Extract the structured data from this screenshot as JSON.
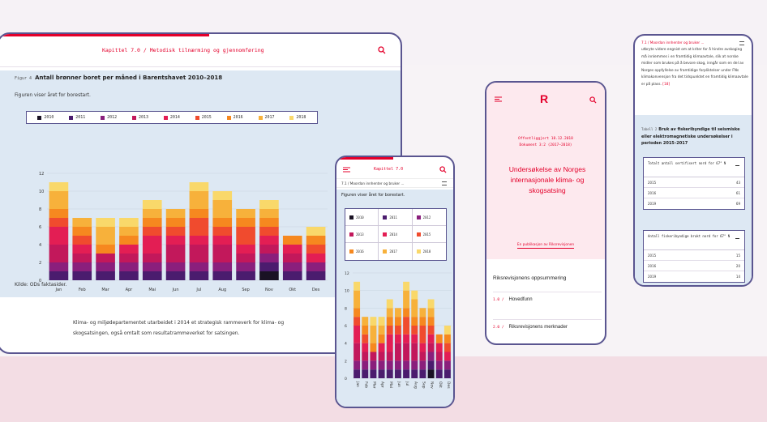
{
  "tablet": {
    "chapter_title": "Kapittel 7.0 / Metodisk tilnærming og gjennomføring",
    "figure_prefix": "Figur 4",
    "figure_title": "Antall brønner boret per måned i Barentshavet 2010–2018",
    "figure_subtitle": "Figuren viser året for borestart.",
    "source": "Kilde: ODs faktasider.",
    "paragraph": "Klima- og miljødepartementet utarbeidet i 2014 et strategisk rammeverk for klima- og skogsatsingen, også omtalt som resultatrammeverket for satsingen."
  },
  "phone1": {
    "chapter_title": "Kapittel 7.0",
    "breadcrumb": "7.1 / Moordan innhenter og bruker ...",
    "figure_subtitle": "Figuren viser året for borestart."
  },
  "phone2": {
    "logo": "R",
    "published": "Offentliggjort 18.12.2018",
    "document": "Dokument 3:2 (2017–2018)",
    "title": "Undersøkelse av Norges internasjonale klima- og skogsatsing",
    "link": "En publikasjon av Riksrevisjonen",
    "summary_heading": "Riksrevisjonens oppsummering",
    "items": [
      {
        "num": "1.0 /",
        "label": "Hovedfunn"
      },
      {
        "num": "2.0 /",
        "label": "Riksrevisjonens merknader"
      }
    ]
  },
  "phone3": {
    "breadcrumb": "7.1 / Moordan innhenter og bruker ...",
    "text": "utbryte videre engnist om at kriter for å hindre avskoging må innlemmes i en framtidig klimaavtale, slik at norske midler som brukes på å bevare skog, inngår som en del av Norges oppfyllelse av framtidige forpliktelser under FNs klimakonvensjon fra det tidspunktet en framtidig klimaavtale er på plass.",
    "ref": "[18]",
    "table_prefix": "Tabell 2",
    "table_title": "Bruk av fiskeribyndige til seismiske eller elektromagnetiske undersøkelser i perioden 2015–2017",
    "tables": [
      {
        "header": "Totalt antall sertifisert nord for 67° N",
        "rows": [
          [
            "2015",
            "43"
          ],
          [
            "2016",
            "61"
          ],
          [
            "2019",
            "69"
          ]
        ]
      },
      {
        "header": "Antall fiskeribyndige brukt nord for 67° N",
        "rows": [
          [
            "2015",
            "15"
          ],
          [
            "2016",
            "20"
          ],
          [
            "2019",
            "14"
          ]
        ]
      }
    ]
  },
  "chart_data": [
    {
      "type": "bar",
      "stacked": true,
      "title": "Antall brønner boret per måned i Barentshavet 2010–2018",
      "subtitle": "Figuren viser året for borestart.",
      "categories": [
        "Jan",
        "Feb",
        "Mar",
        "Apr",
        "Mai",
        "Jun",
        "Jul",
        "Aug",
        "Sep",
        "Nov",
        "Okt",
        "Des"
      ],
      "ylim": [
        0,
        12
      ],
      "yticks": [
        0,
        2,
        4,
        6,
        8,
        10,
        12
      ],
      "legend_position": "top",
      "series": [
        {
          "name": "2010",
          "color": "#1a1224",
          "values": [
            0,
            0,
            0,
            0,
            0,
            0,
            0,
            0,
            0,
            1,
            0,
            0
          ]
        },
        {
          "name": "2011",
          "color": "#4b1c6e",
          "values": [
            1,
            1,
            1,
            1,
            1,
            1,
            1,
            1,
            1,
            1,
            1,
            1
          ]
        },
        {
          "name": "2012",
          "color": "#8a1f7c",
          "values": [
            1,
            1,
            1,
            1,
            1,
            1,
            1,
            1,
            1,
            1,
            1,
            1
          ]
        },
        {
          "name": "2013",
          "color": "#c2185b",
          "values": [
            2,
            1,
            1,
            1,
            1,
            2,
            2,
            2,
            1,
            1,
            1,
            0
          ]
        },
        {
          "name": "2014",
          "color": "#e31e54",
          "values": [
            2,
            1,
            0,
            1,
            2,
            1,
            1,
            1,
            1,
            1,
            1,
            1
          ]
        },
        {
          "name": "2015",
          "color": "#f04b2e",
          "values": [
            1,
            1,
            0,
            0,
            1,
            1,
            2,
            1,
            2,
            1,
            0,
            1
          ]
        },
        {
          "name": "2016",
          "color": "#f6881f",
          "values": [
            1,
            1,
            1,
            1,
            1,
            1,
            1,
            1,
            1,
            1,
            1,
            1
          ]
        },
        {
          "name": "2017",
          "color": "#f7b13b",
          "values": [
            2,
            1,
            2,
            1,
            1,
            1,
            2,
            2,
            1,
            1,
            0,
            0
          ]
        },
        {
          "name": "2018",
          "color": "#f9d86a",
          "values": [
            1,
            0,
            1,
            1,
            1,
            0,
            1,
            1,
            0,
            1,
            0,
            1
          ]
        }
      ],
      "source": "Kilde: ODs faktasider."
    }
  ]
}
